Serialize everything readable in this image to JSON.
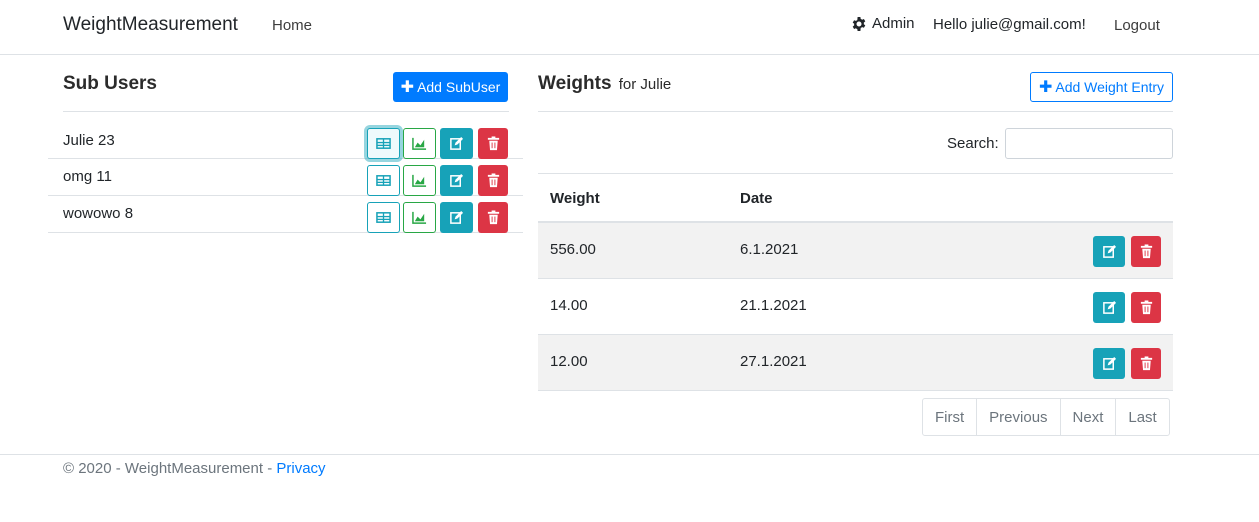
{
  "navbar": {
    "brand": "WeightMeasurement",
    "home": "Home",
    "admin": "Admin",
    "hello": "Hello julie@gmail.com!",
    "logout": "Logout"
  },
  "subusers": {
    "title": "Sub Users",
    "add_label": "Add SubUser",
    "items": [
      {
        "label": "Julie 23"
      },
      {
        "label": "omg 11"
      },
      {
        "label": "wowowo 8"
      }
    ]
  },
  "weights": {
    "title": "Weights",
    "subtitle": "for Julie",
    "add_label": "Add Weight Entry",
    "search_label": "Search:",
    "search_value": "",
    "columns": [
      "Weight",
      "Date"
    ],
    "rows": [
      {
        "weight": "556.00",
        "date": "6.1.2021"
      },
      {
        "weight": "14.00",
        "date": "21.1.2021"
      },
      {
        "weight": "12.00",
        "date": "27.1.2021"
      }
    ],
    "pagination": [
      "First",
      "Previous",
      "Next",
      "Last"
    ]
  },
  "footer": {
    "text": "© 2020 - WeightMeasurement - ",
    "privacy": "Privacy"
  },
  "colors": {
    "primary": "#007bff",
    "info": "#17a2b8",
    "success": "#28a745",
    "danger": "#dc3545"
  },
  "icons": [
    "gear-icon",
    "plus-icon",
    "table-icon",
    "chart-icon",
    "edit-icon",
    "trash-icon"
  ]
}
